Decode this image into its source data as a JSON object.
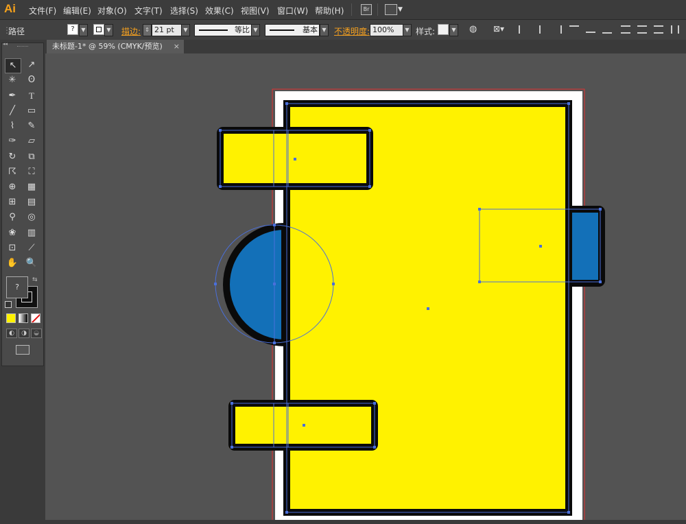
{
  "app": {
    "logo": "Ai"
  },
  "menu": [
    {
      "id": "file",
      "label": "文件(F)"
    },
    {
      "id": "edit",
      "label": "编辑(E)"
    },
    {
      "id": "object",
      "label": "对象(O)"
    },
    {
      "id": "type",
      "label": "文字(T)"
    },
    {
      "id": "select",
      "label": "选择(S)"
    },
    {
      "id": "effect",
      "label": "效果(C)"
    },
    {
      "id": "view",
      "label": "视图(V)"
    },
    {
      "id": "window",
      "label": "窗口(W)"
    },
    {
      "id": "help",
      "label": "帮助(H)"
    }
  ],
  "menubar_icons": {
    "bridge": "Br"
  },
  "control": {
    "selection_type": "路径",
    "fill_swatch_mark": "?",
    "stroke_label": "描边:",
    "stroke_weight": "21 pt",
    "profile_label": "等比",
    "brush_label": "基本",
    "opacity_label": "不透明度:",
    "opacity_value": "100%",
    "style_label": "样式:"
  },
  "document": {
    "tab_title": "未标题-1* @ 59% (CMYK/预览)",
    "close_glyph": "×"
  },
  "tools": {
    "type_glyph": "T",
    "fill_default_mark": "?"
  },
  "colors": {
    "yellow": "#FFF200",
    "blue": "#1370B8",
    "stroke": "#0A0A0A",
    "selection": "#4A6FDA",
    "artboard_border": "#E53030"
  }
}
